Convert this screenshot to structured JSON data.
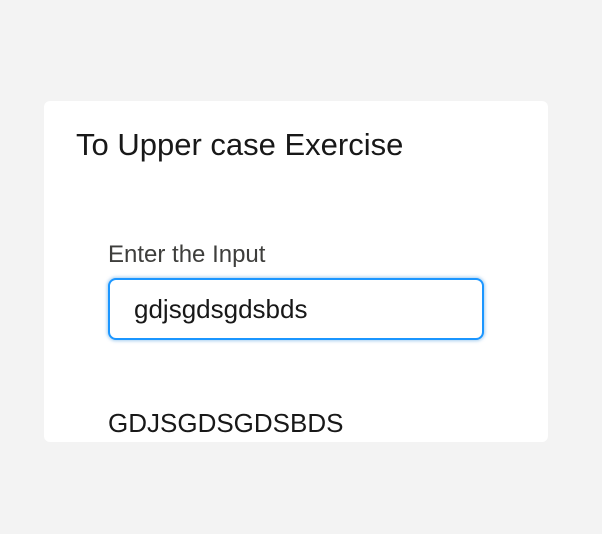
{
  "card": {
    "title": "To Upper case Exercise"
  },
  "form": {
    "input_label": "Enter the Input",
    "input_value": "gdjsgdsgdsbds"
  },
  "result": {
    "output_text": "GDJSGDSGDSBDS"
  },
  "colors": {
    "focus_border": "#1b96ff",
    "page_background": "#f3f3f3",
    "card_background": "#ffffff"
  }
}
